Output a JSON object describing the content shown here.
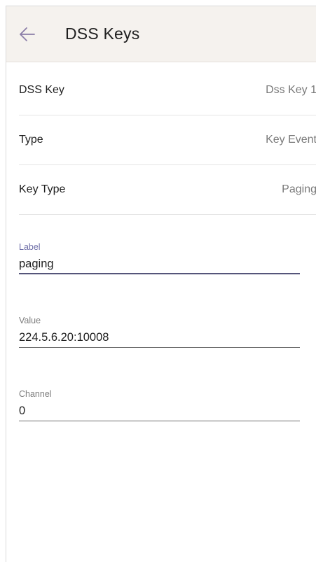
{
  "header": {
    "back_icon": "arrow-back-icon",
    "title": "DSS Keys"
  },
  "settings": [
    {
      "label": "DSS Key",
      "value": "Dss Key 1"
    },
    {
      "label": "Type",
      "value": "Key Event"
    },
    {
      "label": "Key Type",
      "value": "Paging"
    }
  ],
  "fields": {
    "label": {
      "caption": "Label",
      "value": "paging"
    },
    "value": {
      "caption": "Value",
      "value": "224.5.6.20:10008"
    },
    "channel": {
      "caption": "Channel",
      "value": "0"
    }
  },
  "colors": {
    "app_bar": "#f5f2ee",
    "accent": "#6f6fa8",
    "back_arrow": "#8b7ea8"
  }
}
